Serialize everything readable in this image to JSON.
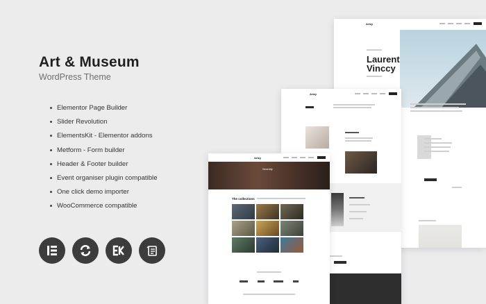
{
  "heading": {
    "title": "Art & Museum",
    "subtitle": "WordPress Theme"
  },
  "features": [
    "Elementor Page Builder",
    "Slider Revolution",
    "ElementsKit - Elementor addons",
    "Metform - Form builder",
    "Header & Footer builder",
    "Event organiser plugin compatible",
    "One click demo importer",
    "WooCommerce compatible"
  ],
  "badges": [
    {
      "icon": "elementor-icon"
    },
    {
      "icon": "slider-revolution-icon"
    },
    {
      "icon": "elementskit-icon"
    },
    {
      "icon": "metform-icon"
    }
  ],
  "mockups": {
    "logo": "Artzy",
    "hero_name": "Laurent Vinccy",
    "hero_line1": "Laurent",
    "hero_line2": "Vinccy",
    "collections_title": "The collections"
  },
  "colors": {
    "background": "#ececed",
    "badge": "#3c3c3c",
    "text": "#1f1f1f"
  }
}
